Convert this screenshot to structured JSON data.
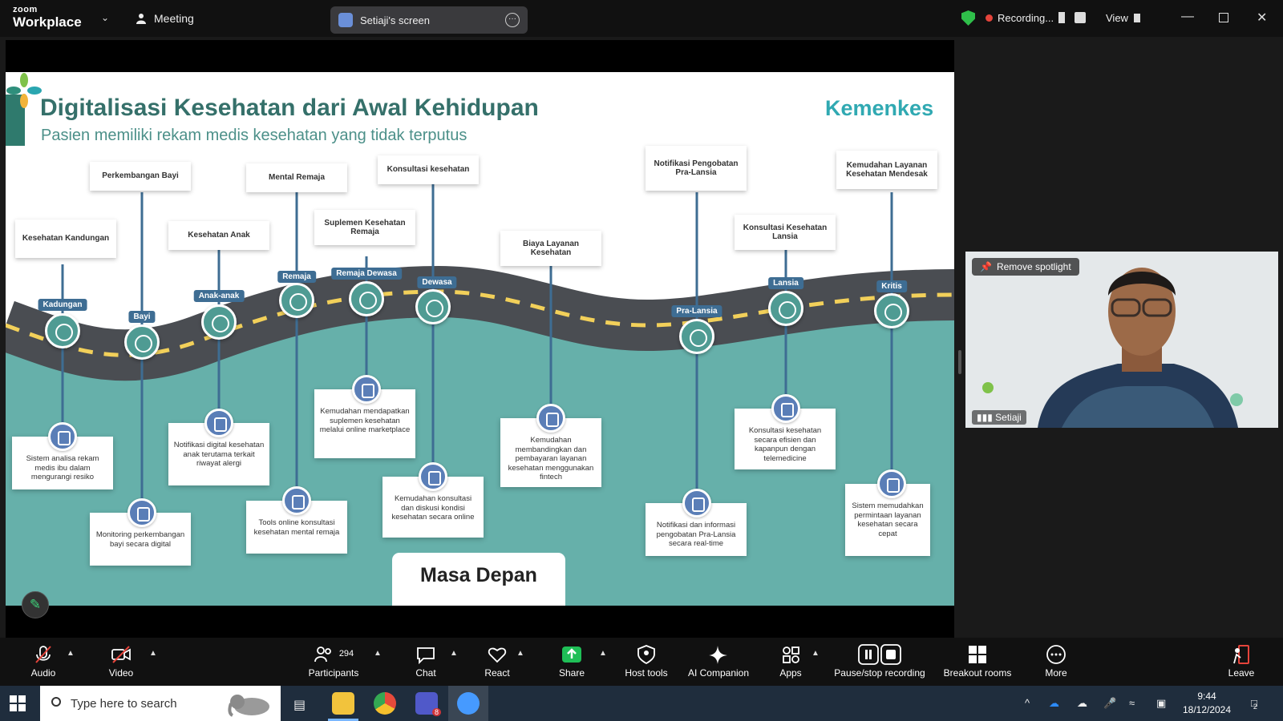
{
  "app": {
    "logo_small": "zoom",
    "logo_name": "Workplace",
    "meeting_label": "Meeting",
    "screen_share_label": "Setiaji's screen",
    "recording_label": "Recording...",
    "view_label": "View"
  },
  "slide": {
    "title": "Digitalisasi Kesehatan dari Awal Kehidupan",
    "subtitle": "Pasien memiliki rekam medis kesehatan yang tidak terputus",
    "brand": "Kemenkes",
    "footer_label": "Masa Depan",
    "topics": [
      {
        "label": "Kesehatan Kandungan"
      },
      {
        "label": "Perkembangan Bayi"
      },
      {
        "label": "Kesehatan Anak"
      },
      {
        "label": "Mental Remaja"
      },
      {
        "label": "Suplemen Kesehatan Remaja"
      },
      {
        "label": "Konsultasi kesehatan"
      },
      {
        "label": "Biaya Layanan Kesehatan"
      },
      {
        "label": "Notifikasi Pengobatan Pra-Lansia"
      },
      {
        "label": "Konsultasi Kesehatan Lansia"
      },
      {
        "label": "Kemudahan Layanan Kesehatan Mendesak"
      }
    ],
    "stages": [
      {
        "label": "Kadungan"
      },
      {
        "label": "Bayi"
      },
      {
        "label": "Anak-anak"
      },
      {
        "label": "Remaja"
      },
      {
        "label": "Remaja Dewasa"
      },
      {
        "label": "Dewasa"
      },
      {
        "label": "Pra-Lansia"
      },
      {
        "label": "Lansia"
      },
      {
        "label": "Kritis"
      }
    ],
    "cards": [
      {
        "text": "Sistem analisa rekam medis ibu dalam mengurangi resiko"
      },
      {
        "text": "Monitoring perkembangan bayi secara digital"
      },
      {
        "text": "Notifikasi digital kesehatan anak terutama terkait riwayat alergi"
      },
      {
        "text": "Tools online konsultasi kesehatan mental remaja"
      },
      {
        "text": "Kemudahan mendapatkan suplemen kesehatan melalui online marketplace"
      },
      {
        "text": "Kemudahan konsultasi dan diskusi kondisi kesehatan secara online"
      },
      {
        "text": "Kemudahan membandingkan dan pembayaran layanan kesehatan menggunakan fintech"
      },
      {
        "text": "Notifikasi dan informasi pengobatan Pra-Lansia secara real-time"
      },
      {
        "text": "Konsultasi kesehatan secara efisien dan kapanpun dengan telemedicine"
      },
      {
        "text": "Sistem memudahkan permintaan layanan kesehatan secara cepat"
      }
    ]
  },
  "video": {
    "remove_spotlight": "Remove spotlight",
    "participant_name": "Setiaji"
  },
  "toolbar": {
    "audio": "Audio",
    "video": "Video",
    "participants": "Participants",
    "participant_count": "294",
    "chat": "Chat",
    "react": "React",
    "share": "Share",
    "host_tools": "Host tools",
    "ai_companion": "AI Companion",
    "apps": "Apps",
    "pause_stop_recording": "Pause/stop recording",
    "breakout_rooms": "Breakout rooms",
    "more": "More",
    "leave": "Leave"
  },
  "taskbar": {
    "search_placeholder": "Type here to search",
    "time": "9:44",
    "date": "18/12/2024",
    "teams_badge": "8",
    "notification_count": "2"
  },
  "colors": {
    "road": "#4a4d52",
    "teal_ground": "#66b0aa",
    "stage_badge": "#3e6d93",
    "title": "#35706a",
    "share_green": "#1fbf57",
    "recording_red": "#e5443b"
  }
}
